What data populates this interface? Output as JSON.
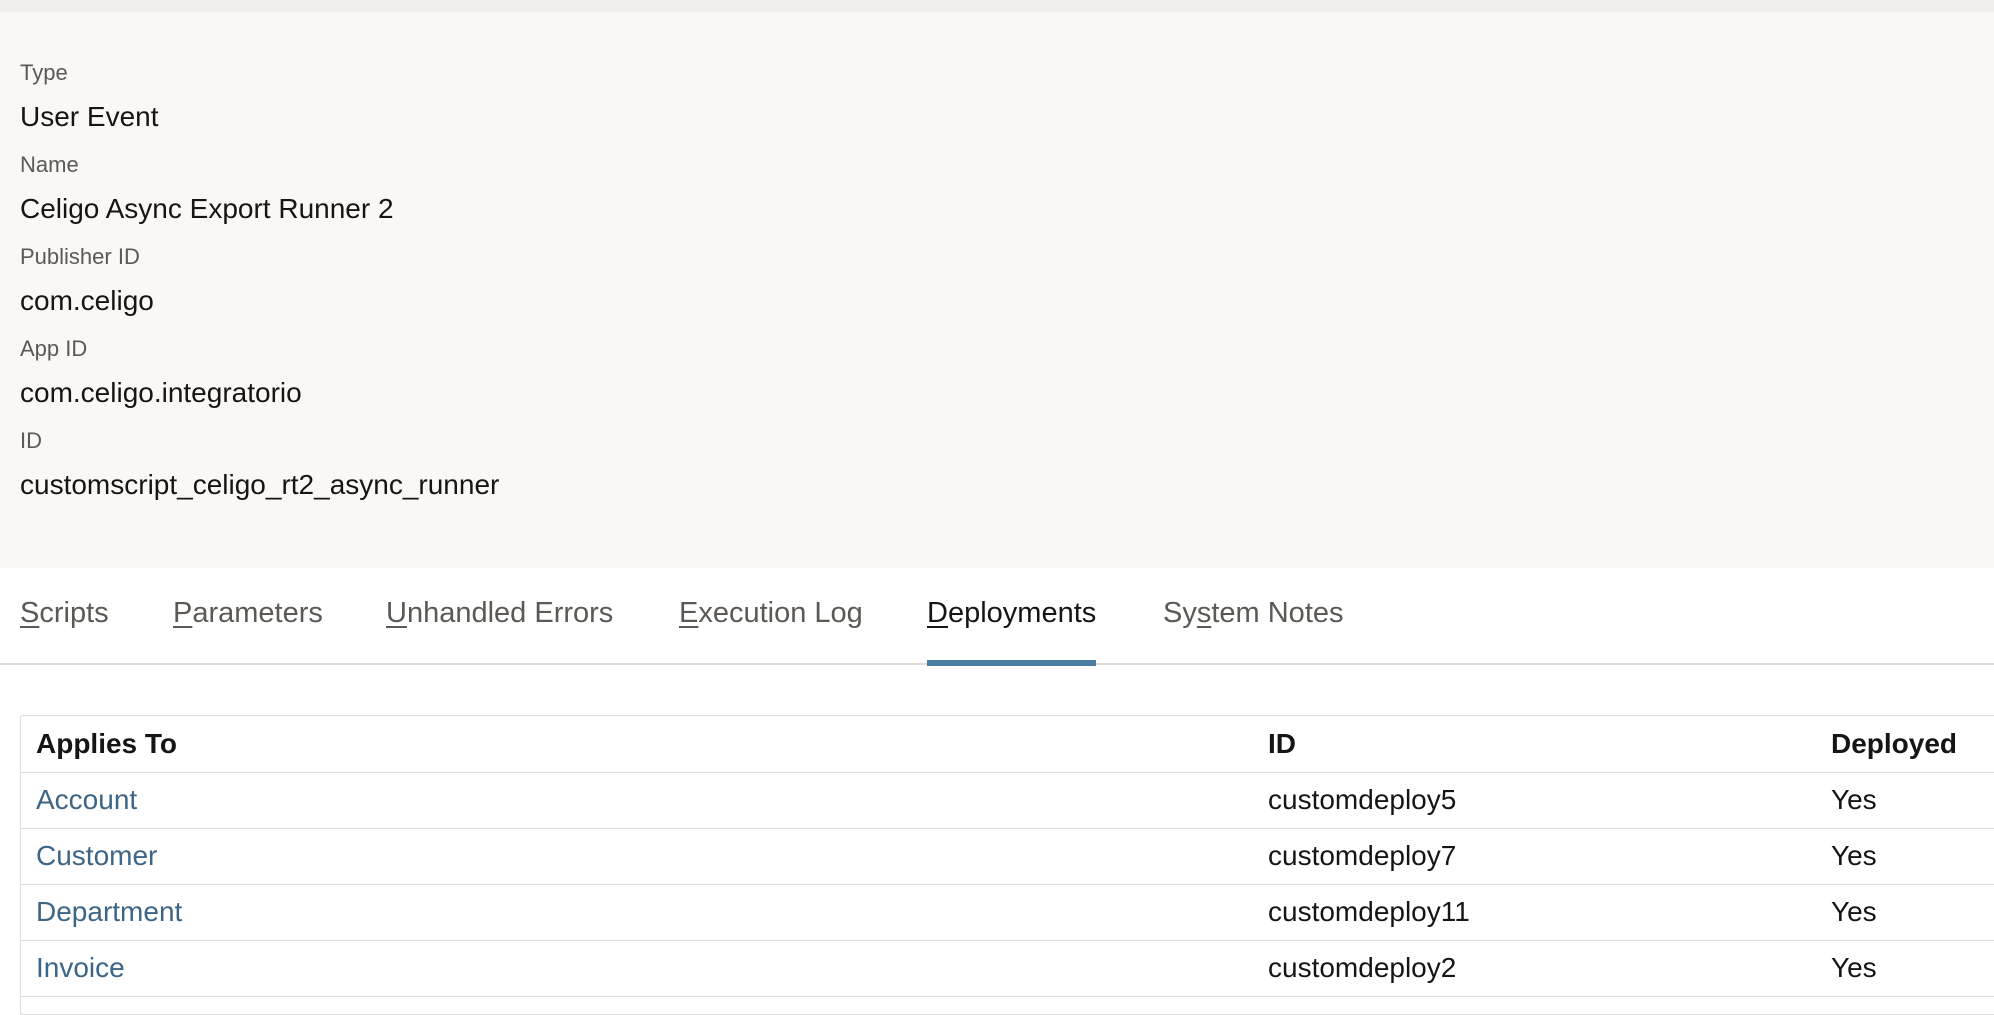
{
  "fields": [
    {
      "label": "Type",
      "value": "User Event"
    },
    {
      "label": "Name",
      "value": "Celigo Async Export Runner 2"
    },
    {
      "label": "Publisher ID",
      "value": "com.celigo"
    },
    {
      "label": "App ID",
      "value": "com.celigo.integratorio"
    },
    {
      "label": "ID",
      "value": "customscript_celigo_rt2_async_runner"
    }
  ],
  "tabs": [
    {
      "key": "S",
      "rest": "cripts"
    },
    {
      "key": "P",
      "rest": "arameters"
    },
    {
      "key": "U",
      "rest": "nhandled Errors"
    },
    {
      "key": "E",
      "rest": "xecution Log"
    },
    {
      "key": "D",
      "rest": "eployments"
    },
    {
      "pre": "Sy",
      "key": "s",
      "rest": "tem Notes"
    }
  ],
  "active_tab": "Deployments",
  "table": {
    "headers": [
      "Applies To",
      "ID",
      "Deployed"
    ],
    "rows": [
      [
        "Account",
        "customdeploy5",
        "Yes"
      ],
      [
        "Customer",
        "customdeploy7",
        "Yes"
      ],
      [
        "Department",
        "customdeploy11",
        "Yes"
      ],
      [
        "Invoice",
        "customdeploy2",
        "Yes"
      ]
    ]
  },
  "colors": {
    "accent": "#4a7ea1",
    "link": "#3d6585",
    "panel": "#f9f8f6"
  }
}
